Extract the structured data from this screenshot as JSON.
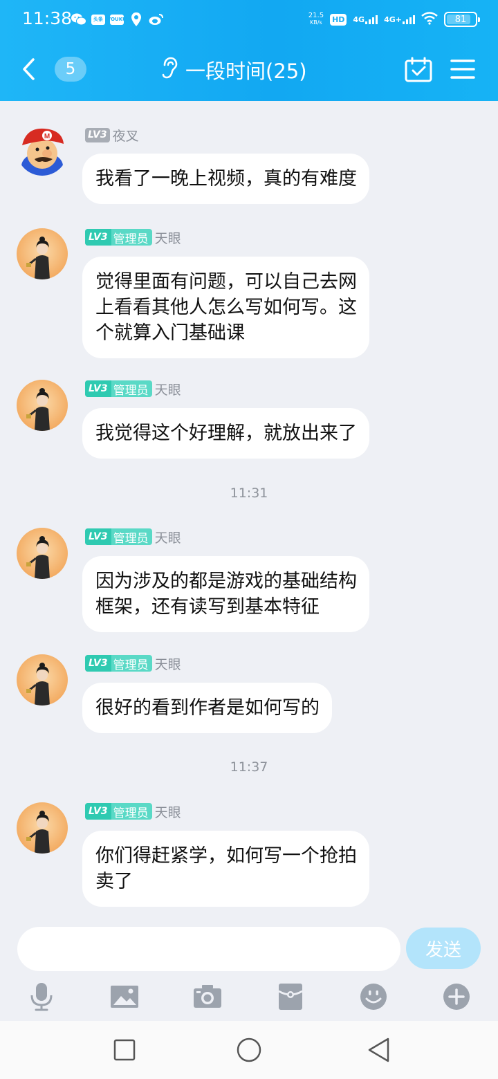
{
  "status_bar": {
    "time": "11:38",
    "net_speed_value": "21.5",
    "net_speed_unit": "KB/s",
    "hd_label": "HD",
    "sim1_label": "4G",
    "sim2_label": "4G+",
    "battery": "81",
    "notif_box_1": "头条",
    "notif_box_2": "YOUKU"
  },
  "header": {
    "back_icon": "chevron-left-icon",
    "unread_count": "5",
    "title": "一段时间(25)",
    "ear_icon": "ear-icon",
    "calendar_icon": "calendar-check-icon",
    "menu_icon": "hamburger-menu-icon"
  },
  "messages": [
    {
      "badge": "LV3",
      "role": "",
      "name": "夜叉",
      "text_lines": [
        "我看了一晚上视频，真的有难度"
      ],
      "avatar": "mario"
    },
    {
      "badge": "LV3",
      "role": "管理员",
      "name": "天眼",
      "text_lines": [
        "觉得里面有问题，可以自己去网",
        "上看看其他人怎么写如何写。这",
        "个就算入门基础课"
      ],
      "avatar": "lady"
    },
    {
      "badge": "LV3",
      "role": "管理员",
      "name": "天眼",
      "text_lines": [
        "我觉得这个好理解，就放出来了"
      ],
      "avatar": "lady"
    },
    {
      "badge": "LV3",
      "role": "管理员",
      "name": "天眼",
      "text_lines": [
        "因为涉及的都是游戏的基础结构",
        "框架，还有读写到基本特征"
      ],
      "avatar": "lady"
    },
    {
      "badge": "LV3",
      "role": "管理员",
      "name": "天眼",
      "text_lines": [
        "很好的看到作者是如何写的"
      ],
      "avatar": "lady"
    },
    {
      "badge": "LV3",
      "role": "管理员",
      "name": "天眼",
      "text_lines": [
        "你们得赶紧学，如何写一个抢拍",
        "卖了"
      ],
      "avatar": "lady"
    }
  ],
  "timestamps": [
    "11:31",
    "11:37"
  ],
  "composer": {
    "placeholder": "",
    "send_label": "发送"
  },
  "toolbar": [
    "microphone-icon",
    "image-icon",
    "camera-icon",
    "red-packet-icon",
    "emoji-icon",
    "plus-icon"
  ],
  "system_nav": [
    "recent-apps-icon",
    "home-icon",
    "back-triangle-icon"
  ],
  "colors": {
    "header": "#12a8f2",
    "background": "#eef0f5",
    "admin_badge": "#2fcab1",
    "send_disabled": "#b3e4fb"
  }
}
